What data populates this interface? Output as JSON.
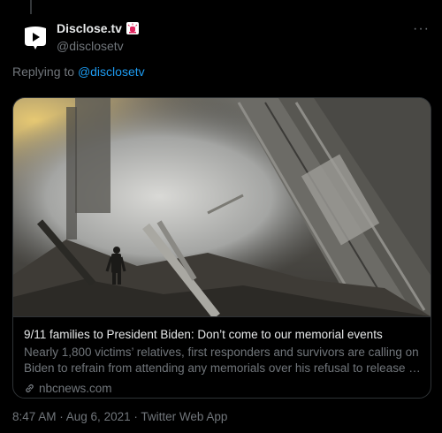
{
  "author": {
    "display_name": "Disclose.tv",
    "handle": "@disclosetv",
    "avatar_icon": "disclosetv-logo-icon",
    "badge_icon": "siren-icon"
  },
  "more_icon": "more-options-icon",
  "more_label": "···",
  "reply": {
    "prefix": "Replying to",
    "mention": "@disclosetv"
  },
  "card": {
    "image_alt": "Firefighter standing in smoke among ground zero rubble",
    "title": "9/11 families to President Biden: Don’t come to our memorial events",
    "description_line1": "Nearly 1,800 victims’ relatives, first responders and survivors are calling on",
    "description_line2": "Biden to refrain from attending any memorials over his refusal to release Sep…",
    "domain_icon": "link-icon",
    "domain": "nbcnews.com"
  },
  "timestamp": "8:47 AM · Aug 6, 2021 · Twitter Web App",
  "colors": {
    "background": "#000000",
    "text_primary": "#e7e9ea",
    "text_secondary": "#71767b",
    "accent": "#1d9bf0",
    "border": "#2f3336",
    "badge_red": "#e0245e"
  }
}
